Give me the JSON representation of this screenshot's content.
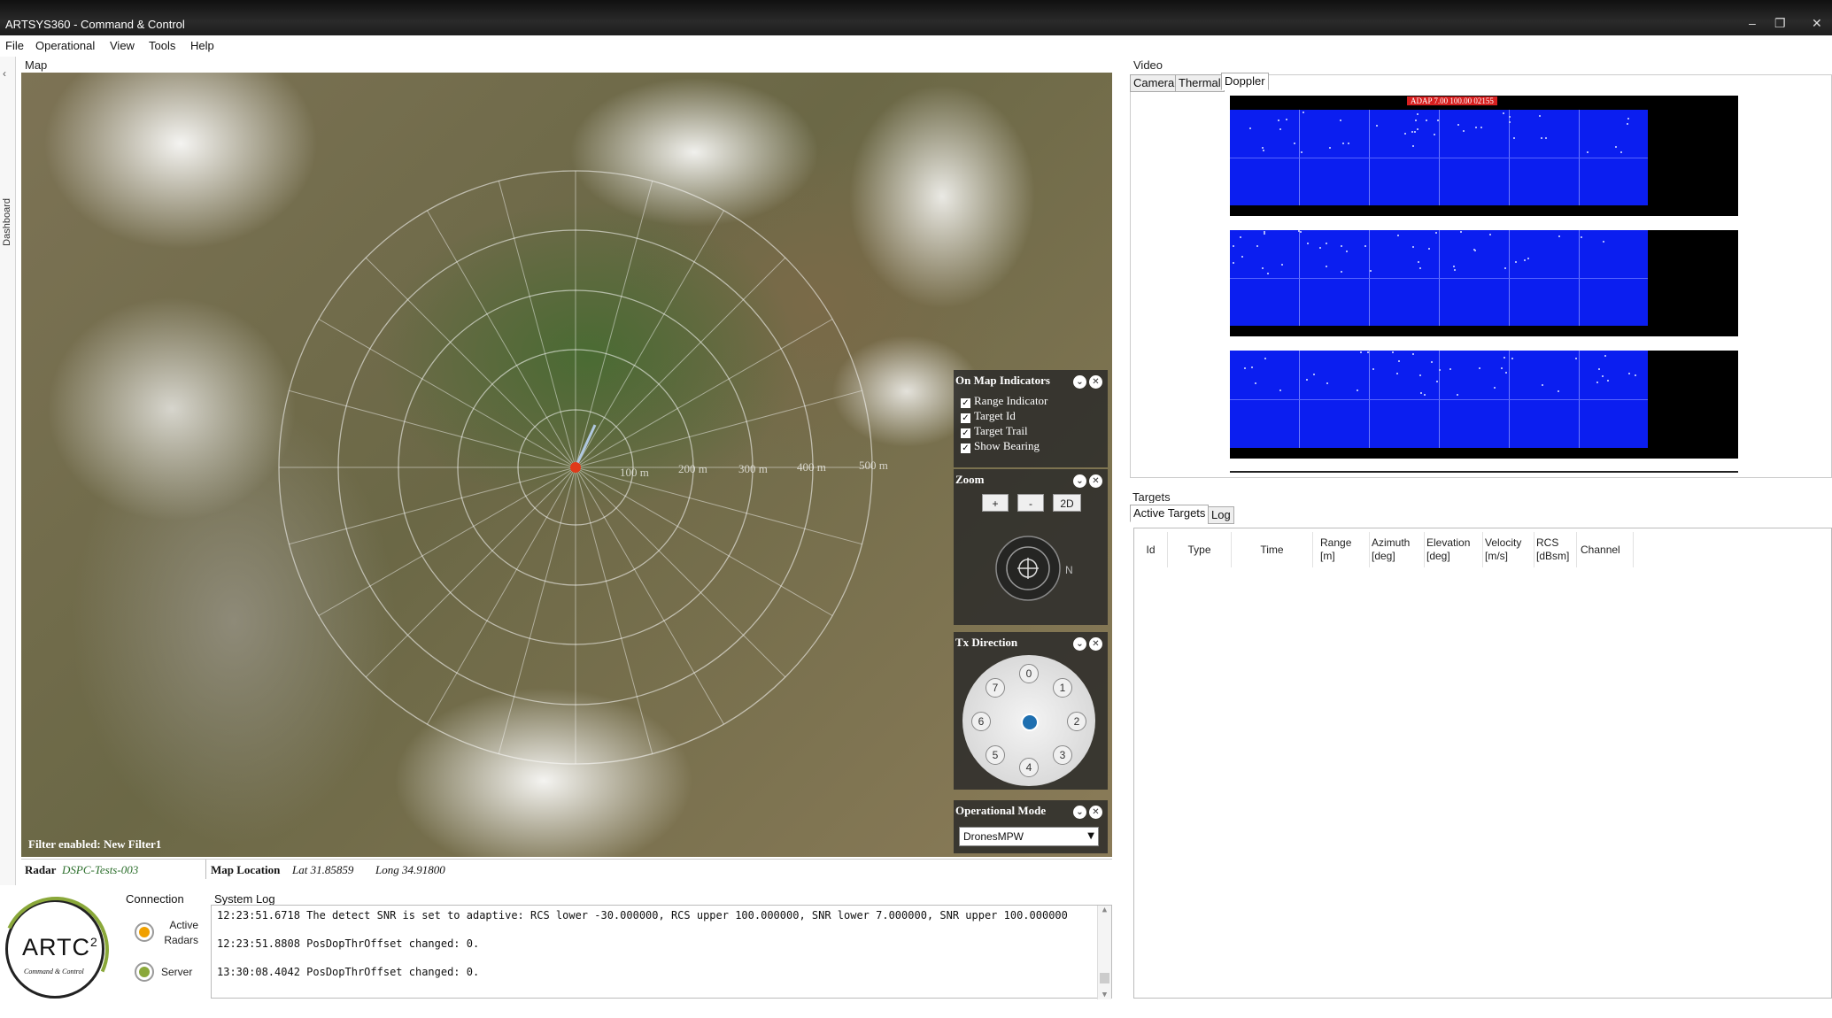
{
  "window": {
    "title": "ARTSYS360 - Command & Control",
    "controls": [
      "–",
      "❐",
      "✕"
    ]
  },
  "menu": [
    "File",
    "Operational",
    "View",
    "Tools",
    "Help"
  ],
  "sidebar": {
    "label": "Dashboard",
    "collapse_glyph": "‹"
  },
  "map_panel": {
    "label": "Map",
    "range_rings": [
      "100 m",
      "200 m",
      "300 m",
      "400 m",
      "500 m"
    ],
    "filter_text": "Filter enabled: New Filter1"
  },
  "overlays": {
    "indicators": {
      "title": "On Map Indicators",
      "items": [
        {
          "label": "Range Indicator",
          "checked": true
        },
        {
          "label": "Target Id",
          "checked": true
        },
        {
          "label": "Target Trail",
          "checked": true
        },
        {
          "label": "Show Bearing",
          "checked": true
        }
      ]
    },
    "zoom": {
      "title": "Zoom",
      "plus": "+",
      "minus": "-",
      "mode": "2D",
      "north": "N"
    },
    "tx": {
      "title": "Tx Direction",
      "buttons": [
        "0",
        "1",
        "2",
        "3",
        "4",
        "5",
        "6",
        "7"
      ]
    },
    "opmode": {
      "title": "Operational Mode",
      "selected": "DronesMPW"
    }
  },
  "status": {
    "radar_label": "Radar",
    "radar_value": "DSPC-Tests-003",
    "maploc_label": "Map Location",
    "lat": "Lat 31.85859",
    "long": "Long 34.91800"
  },
  "logo": {
    "text": "ARTC",
    "superscript": "2",
    "subtitle": "Command & Control"
  },
  "connection": {
    "label": "Connection",
    "active_radars": "Active Radars",
    "server": "Server",
    "active_color": "#f0a000",
    "server_color": "#8aa83a"
  },
  "system_log": {
    "label": "System Log",
    "lines": [
      "12:23:51.6718 The detect SNR is set to adaptive: RCS lower -30.000000, RCS upper 100.000000, SNR lower 7.000000, SNR upper 100.000000",
      "12:23:51.8808 PosDopThrOffset changed: 0.",
      "13:30:08.4042 PosDopThrOffset changed: 0."
    ]
  },
  "video": {
    "label": "Video",
    "tabs": [
      "Camera",
      "Thermal",
      "Doppler"
    ],
    "active_tab": "Doppler",
    "doppler_header": "ADAP 7.00   100.00 02155",
    "doppler_color": "#0b1ef0"
  },
  "targets": {
    "label": "Targets",
    "tabs": [
      "Active Targets",
      "Log"
    ],
    "active_tab": "Active Targets",
    "columns": [
      "Id",
      "Type",
      "Time",
      "Range [m]",
      "Azimuth [deg]",
      "Elevation [deg]",
      "Velocity [m/s]",
      "RCS [dBsm]",
      "Channel"
    ]
  }
}
